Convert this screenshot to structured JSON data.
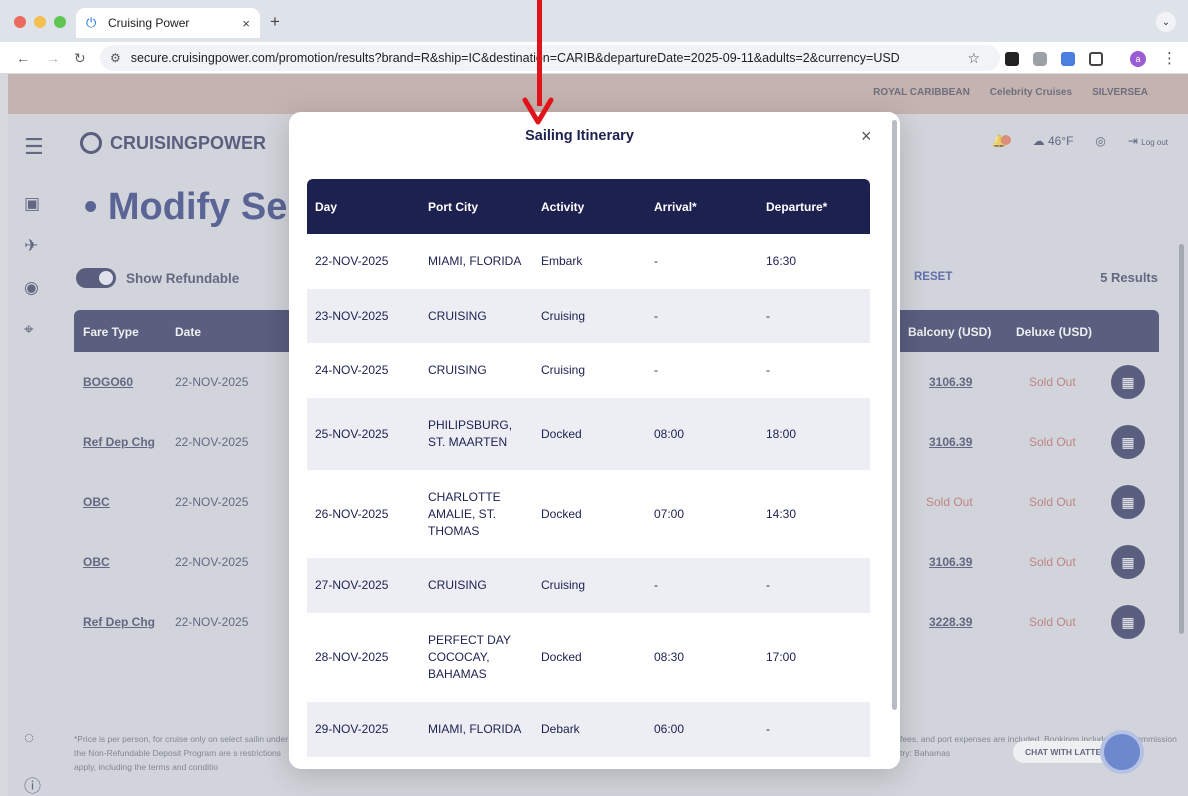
{
  "browser": {
    "tab_title": "Cruising Power",
    "tab_close": "×",
    "new_tab": "+",
    "url_host": "secure.cruisingpower.com",
    "url_path": "/promotion/results?brand=R&ship=IC&destination=CARIB&departureDate=2025-09-11&adults=2&currency=USD",
    "profile_initial": "a"
  },
  "header": {
    "logo_text": "CRUISINGPOWER",
    "brands": [
      "ROYAL CARIBBEAN",
      "Celebrity Cruises",
      "SILVERSEA"
    ],
    "weather": "46°F",
    "logout": "Log out"
  },
  "page": {
    "heading": "Modify Se",
    "show_refundable": "Show Refundable",
    "reset": "RESET",
    "results": "5 Results",
    "columns": {
      "fare_type": "Fare Type",
      "date": "Date",
      "balcony": "Balcony (USD)",
      "deluxe": "Deluxe (USD)"
    },
    "rows": [
      {
        "fare_type": "BOGO60",
        "date": "22-NOV-2025",
        "balcony": "3106.39",
        "deluxe": "Sold Out"
      },
      {
        "fare_type": "Ref Dep Chg",
        "date": "22-NOV-2025",
        "balcony": "3106.39",
        "deluxe": "Sold Out"
      },
      {
        "fare_type": "OBC",
        "date": "22-NOV-2025",
        "balcony": "Sold Out",
        "deluxe": "Sold Out"
      },
      {
        "fare_type": "OBC",
        "date": "22-NOV-2025",
        "balcony": "3106.39",
        "deluxe": "Sold Out"
      },
      {
        "fare_type": "Ref Dep Chg",
        "date": "22-NOV-2025",
        "balcony": "3228.39",
        "deluxe": "Sold Out"
      }
    ],
    "disclaimer_left": "*Price is per person, for cruise only on select sailin under the Non-Refundable Deposit Program are s restrictions apply, including the terms and conditio",
    "disclaimer_right": "fees, and port expenses are included. Bookings includes non-commission try: Bahamas",
    "chat_label": "CHAT WITH LATTE"
  },
  "modal": {
    "title": "Sailing Itinerary",
    "close": "×",
    "headers": [
      "Day",
      "Port City",
      "Activity",
      "Arrival*",
      "Departure*"
    ],
    "rows": [
      {
        "day": "22-NOV-2025",
        "port": "MIAMI, FLORIDA",
        "activity": "Embark",
        "arrival": "-",
        "departure": "16:30"
      },
      {
        "day": "23-NOV-2025",
        "port": "CRUISING",
        "activity": "Cruising",
        "arrival": "-",
        "departure": "-"
      },
      {
        "day": "24-NOV-2025",
        "port": "CRUISING",
        "activity": "Cruising",
        "arrival": "-",
        "departure": "-"
      },
      {
        "day": "25-NOV-2025",
        "port": "PHILIPSBURG, ST. MAARTEN",
        "activity": "Docked",
        "arrival": "08:00",
        "departure": "18:00"
      },
      {
        "day": "26-NOV-2025",
        "port": "CHARLOTTE AMALIE, ST. THOMAS",
        "activity": "Docked",
        "arrival": "07:00",
        "departure": "14:30"
      },
      {
        "day": "27-NOV-2025",
        "port": "CRUISING",
        "activity": "Cruising",
        "arrival": "-",
        "departure": "-"
      },
      {
        "day": "28-NOV-2025",
        "port": "PERFECT DAY COCOCAY, BAHAMAS",
        "activity": "Docked",
        "arrival": "08:30",
        "departure": "17:00"
      },
      {
        "day": "29-NOV-2025",
        "port": "MIAMI, FLORIDA",
        "activity": "Debark",
        "arrival": "06:00",
        "departure": "-"
      }
    ]
  },
  "colors": {
    "navy": "#1c2150",
    "annotation": "#e0131a",
    "sold_out": "#b85a55"
  }
}
